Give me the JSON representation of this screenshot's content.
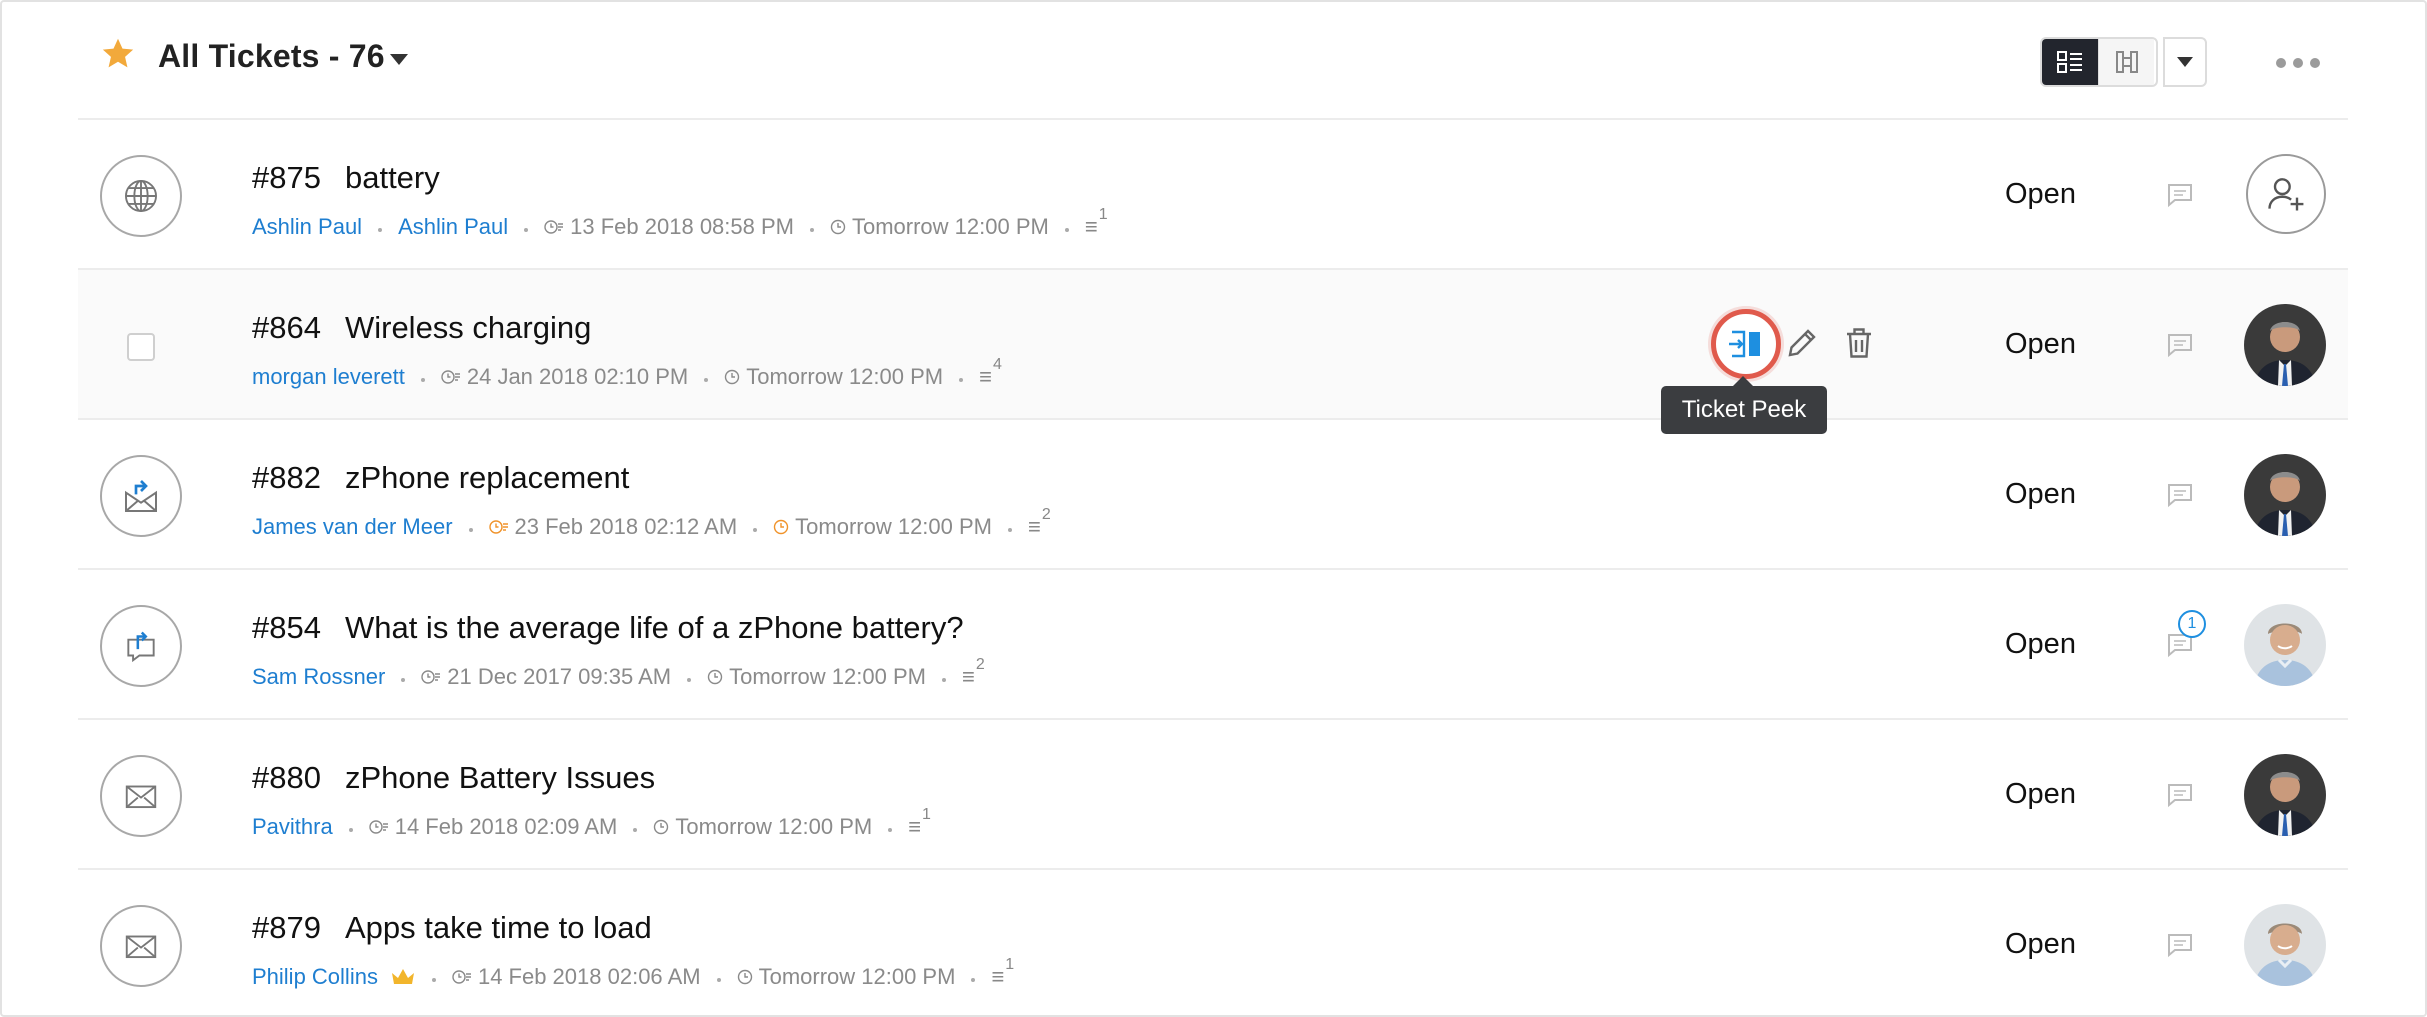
{
  "header": {
    "view_title": "All Tickets - 76",
    "icons": [
      "star-icon",
      "caret-down-icon",
      "list-view-icon",
      "kanban-view-icon",
      "more-icon"
    ]
  },
  "colors": {
    "accent_blue": "#1e7ed0",
    "star": "#f2a93b",
    "overdue_orange": "#f0932b",
    "highlight_ring": "#e05a4c"
  },
  "tooltip": {
    "text": "Ticket Peek"
  },
  "tickets": [
    {
      "id": "#875",
      "subject": "battery",
      "channel_icon": "web-icon",
      "contact": "Ashlin Paul",
      "contact2": "Ashlin Paul",
      "created": "13 Feb 2018 08:58 PM",
      "due": "Tomorrow 12:00 PM",
      "threads": "1",
      "status": "Open",
      "comments": "",
      "assignee": "unassigned"
    },
    {
      "id": "#864",
      "subject": "Wireless charging",
      "channel_icon": "checkbox",
      "contact": "morgan leverett",
      "created": "24 Jan 2018 02:10 PM",
      "due": "Tomorrow 12:00 PM",
      "threads": "4",
      "status": "Open",
      "comments": "",
      "assignee": "agent-1"
    },
    {
      "id": "#882",
      "subject": "zPhone replacement",
      "channel_icon": "email-reply-icon",
      "contact": "James van der Meer",
      "created": "23 Feb 2018 02:12 AM",
      "due": "Tomorrow 12:00 PM",
      "threads": "2",
      "status": "Open",
      "comments": "",
      "assignee": "agent-1",
      "overdue": true
    },
    {
      "id": "#854",
      "subject": "What is the average life of a zPhone battery?",
      "channel_icon": "chat-reply-icon",
      "contact": "Sam Rossner",
      "created": "21 Dec 2017 09:35 AM",
      "due": "Tomorrow 12:00 PM",
      "threads": "2",
      "status": "Open",
      "comments": "1",
      "assignee": "agent-2"
    },
    {
      "id": "#880",
      "subject": "zPhone Battery Issues",
      "channel_icon": "email-icon",
      "contact": "Pavithra",
      "created": "14 Feb 2018 02:09 AM",
      "due": "Tomorrow 12:00 PM",
      "threads": "1",
      "status": "Open",
      "comments": "",
      "assignee": "agent-1"
    },
    {
      "id": "#879",
      "subject": "Apps take time to load",
      "channel_icon": "email-icon",
      "contact": "Philip Collins",
      "created": "14 Feb 2018 02:06 AM",
      "due": "Tomorrow 12:00 PM",
      "threads": "1",
      "status": "Open",
      "comments": "",
      "assignee": "agent-2",
      "vip": true
    }
  ]
}
